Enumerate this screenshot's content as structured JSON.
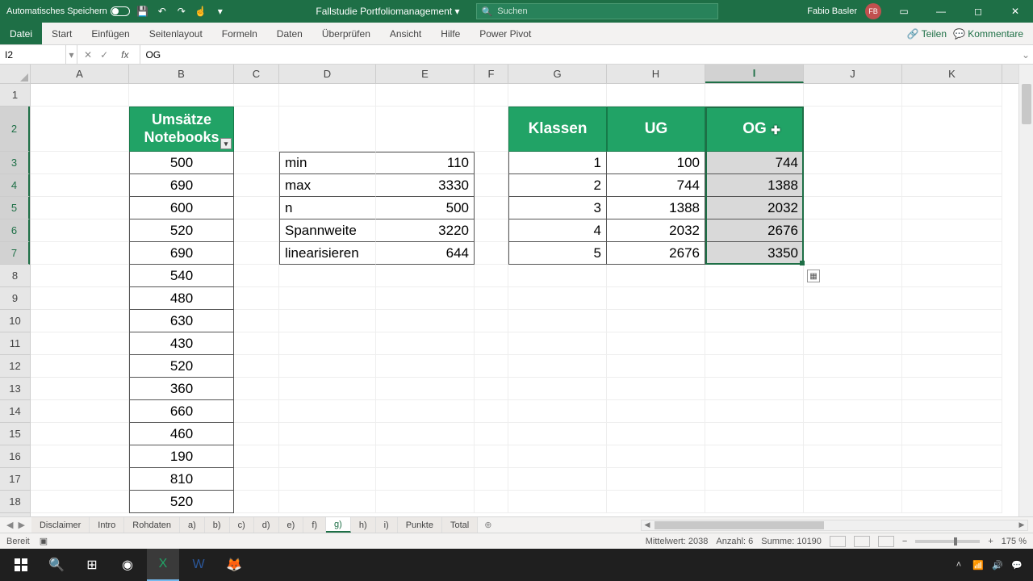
{
  "titlebar": {
    "autosave_label": "Automatisches Speichern",
    "doc_name": "Fallstudie Portfoliomanagement",
    "search_placeholder": "Suchen",
    "user_name": "Fabio Basler",
    "user_initials": "FB"
  },
  "ribbon": {
    "tabs": [
      "Datei",
      "Start",
      "Einfügen",
      "Seitenlayout",
      "Formeln",
      "Daten",
      "Überprüfen",
      "Ansicht",
      "Hilfe",
      "Power Pivot"
    ],
    "share": "Teilen",
    "comments": "Kommentare"
  },
  "formulabar": {
    "name_box": "I2",
    "formula": "OG"
  },
  "columns": [
    "A",
    "B",
    "C",
    "D",
    "E",
    "F",
    "G",
    "H",
    "I",
    "J",
    "K"
  ],
  "row_numbers": [
    1,
    2,
    3,
    4,
    5,
    6,
    7,
    8,
    9,
    10,
    11,
    12,
    13,
    14,
    15,
    16,
    17,
    18
  ],
  "headers": {
    "b2": "Umsätze Notebooks",
    "g2": "Klassen",
    "h2": "UG",
    "i2": "OG"
  },
  "col_b": [
    500,
    690,
    600,
    520,
    690,
    540,
    480,
    630,
    430,
    520,
    360,
    660,
    460,
    190,
    810,
    520
  ],
  "stats_labels": [
    "min",
    "max",
    "n",
    "Spannweite",
    "linearisieren"
  ],
  "stats_values": [
    110,
    3330,
    500,
    3220,
    644
  ],
  "klassen": [
    1,
    2,
    3,
    4,
    5
  ],
  "ug": [
    100,
    744,
    1388,
    2032,
    2676
  ],
  "og": [
    744,
    1388,
    2032,
    2676,
    3350
  ],
  "selection": {
    "active_col": "I",
    "rows": "2-7"
  },
  "sheets": [
    "Disclaimer",
    "Intro",
    "Rohdaten",
    "a)",
    "b)",
    "c)",
    "d)",
    "e)",
    "f)",
    "g)",
    "h)",
    "i)",
    "Punkte",
    "Total"
  ],
  "active_sheet": "g)",
  "status": {
    "ready": "Bereit",
    "avg_label": "Mittelwert:",
    "avg": "2038",
    "count_label": "Anzahl:",
    "count": "6",
    "sum_label": "Summe:",
    "sum": "10190",
    "zoom": "175 %"
  },
  "taskbar": {
    "time": "",
    "date": ""
  }
}
